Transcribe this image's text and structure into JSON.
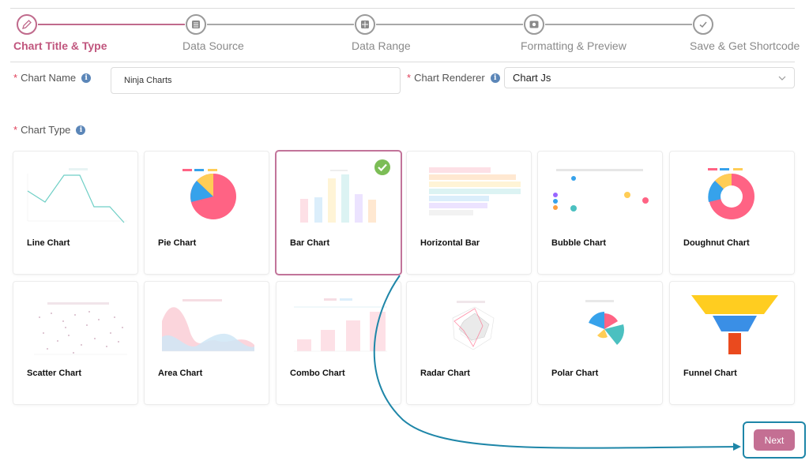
{
  "stepper": {
    "steps": [
      {
        "label": "Chart Title & Type",
        "icon": "pencil-icon",
        "active": true
      },
      {
        "label": "Data Source",
        "icon": "database-icon",
        "active": false
      },
      {
        "label": "Data Range",
        "icon": "range-icon",
        "active": false
      },
      {
        "label": "Formatting & Preview",
        "icon": "preview-icon",
        "active": false
      },
      {
        "label": "Save & Get Shortcode",
        "icon": "checkmark-icon",
        "active": false
      }
    ]
  },
  "form": {
    "chart_name": {
      "label": "Chart Name",
      "required": "*",
      "value": "Ninja Charts"
    },
    "chart_renderer": {
      "label": "Chart Renderer",
      "required": "*",
      "value": "Chart Js"
    },
    "chart_type": {
      "label": "Chart Type",
      "required": "*"
    }
  },
  "chart_types": [
    {
      "name": "Line Chart",
      "selected": false
    },
    {
      "name": "Pie Chart",
      "selected": false
    },
    {
      "name": "Bar Chart",
      "selected": true
    },
    {
      "name": "Horizontal Bar",
      "selected": false
    },
    {
      "name": "Bubble Chart",
      "selected": false
    },
    {
      "name": "Doughnut Chart",
      "selected": false
    },
    {
      "name": "Scatter Chart",
      "selected": false
    },
    {
      "name": "Area Chart",
      "selected": false
    },
    {
      "name": "Combo Chart",
      "selected": false
    },
    {
      "name": "Radar Chart",
      "selected": false
    },
    {
      "name": "Polar Chart",
      "selected": false
    },
    {
      "name": "Funnel Chart",
      "selected": false
    }
  ],
  "next_button": {
    "label": "Next"
  },
  "colors": {
    "accent": "#c06a8c",
    "next": "#c46f93",
    "highlight": "#1e86a8",
    "check": "#7cbd56",
    "pink": "#ff6384",
    "blue": "#36a2eb",
    "yellow": "#ffcd56",
    "teal": "#4bc0c0",
    "purple": "#9966ff"
  }
}
